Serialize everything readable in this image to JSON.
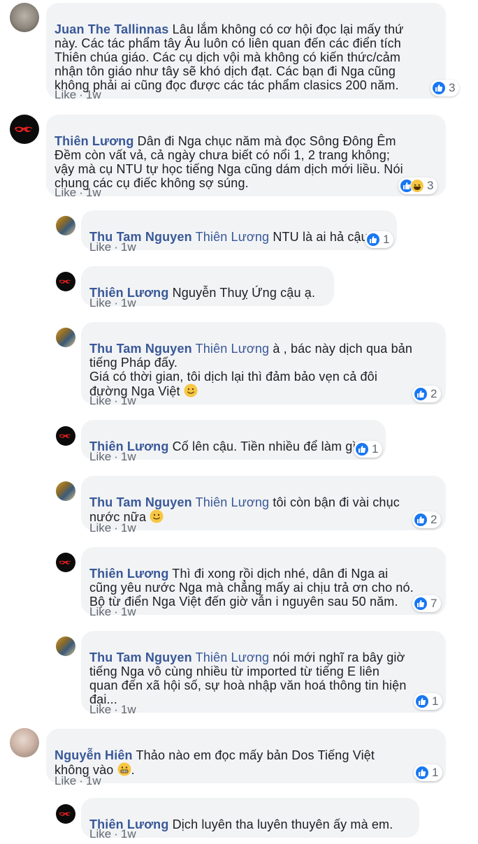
{
  "comments": [
    {
      "author": "Juan The Tallinnas",
      "mention": "",
      "text": "Lâu lắm không có cơ hội đọc lại mấy thứ\nnày. Các tác phẩm tây Âu luôn có liên quan đến các điển tích\nThiên chúa giáo. Các cụ dịch vội mà không có kiến thức/cảm\nnhận tôn giáo như tây sẽ khó dịch đạt. Các bạn đi Nga cũng\nkhông phải ai cũng đọc được các tác phẩm clasics 200 năm.",
      "like": "Like",
      "time": "1w",
      "reactions": "3"
    },
    {
      "author": "Thiên Lương",
      "mention": "",
      "text": "Dân đi Nga chục năm mà đọc Sông Đông Êm\nĐềm còn vất vả, cả ngày chưa biết có nổi 1, 2 trang không;\nvậy mà cụ NTU tự học tiếng Nga cũng dám dịch mới liều. Nói\nchung các cụ điếc không sợ súng.",
      "like": "Like",
      "time": "1w",
      "reactions": "3"
    },
    {
      "author": "Thu Tam Nguyen",
      "mention": "Thiên Lương",
      "text": "NTU là ai hả cậu?",
      "like": "Like",
      "time": "1w",
      "reactions": "1"
    },
    {
      "author": "Thiên Lương",
      "mention": "",
      "text": "Nguyễn Thuỵ Ứng cậu ạ.",
      "like": "Like",
      "time": "1w",
      "reactions": ""
    },
    {
      "author": "Thu Tam Nguyen",
      "mention": "Thiên Lương",
      "text": "à , bác này dịch qua bản\ntiếng Pháp đấy.\nGiá có thời gian, tôi dịch lại thì đảm bảo vẹn cả đôi\nđường Nga Việt",
      "like": "Like",
      "time": "1w",
      "reactions": "2"
    },
    {
      "author": "Thiên Lương",
      "mention": "",
      "text": "Cố lên cậu. Tiền nhiều để làm gì?",
      "like": "Like",
      "time": "1w",
      "reactions": "1"
    },
    {
      "author": "Thu Tam Nguyen",
      "mention": "Thiên Lương",
      "text": "tôi còn bận đi vài chục\nnước nữa",
      "like": "Like",
      "time": "1w",
      "reactions": "2"
    },
    {
      "author": "Thiên Lương",
      "mention": "",
      "text": "Thì đi xong rồi dịch nhé, dân đi Nga ai\ncũng yêu nước Nga mà chẳng mấy ai chịu trả ơn cho nó.\nBộ từ điển Nga Việt đến giờ vẫn i nguyên sau 50 năm.",
      "like": "Like",
      "time": "1w",
      "reactions": "7"
    },
    {
      "author": "Thu Tam Nguyen",
      "mention": "Thiên Lương",
      "text": "nói mới nghĩ ra bây giờ\ntiếng Nga vô cùng nhiều từ imported từ tiếng E liên\nquan đến xã hội số, sự hoà nhập văn hoá thông tin hiện\nđại...",
      "like": "Like",
      "time": "1w",
      "reactions": "1"
    },
    {
      "author": "Nguyễn Hiên",
      "mention": "",
      "text": "Thảo nào em đọc mấy bản Dos Tiếng Việt\nkhông vào",
      "like": "Like",
      "time": "1w",
      "reactions": "1"
    },
    {
      "author": "Thiên Lương",
      "mention": "",
      "text": "Dịch luyên tha luyên thuyên ấy mà em.",
      "like": "Like",
      "time": "1w",
      "reactions": ""
    }
  ],
  "icons": {
    "like": "thumbs-up-icon",
    "haha": "haha-icon",
    "smile": "smiling-face-emoji",
    "grimace": "grimacing-face-emoji"
  },
  "colors": {
    "author": "#385898",
    "bubble": "#f2f3f5",
    "like_reaction": "#1877f2"
  }
}
